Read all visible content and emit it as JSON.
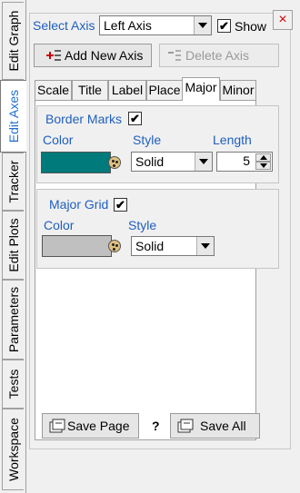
{
  "side_tabs": [
    {
      "label": "Edit Graph",
      "active": false
    },
    {
      "label": "Edit Axes",
      "active": true
    },
    {
      "label": "Tracker",
      "active": false
    },
    {
      "label": "Edit Plots",
      "active": false
    },
    {
      "label": "Parameters",
      "active": false
    },
    {
      "label": "Tests",
      "active": false
    },
    {
      "label": "Workspace",
      "active": false
    }
  ],
  "axis_select": {
    "label": "Select Axis",
    "value": "Left Axis",
    "show_label": "Show",
    "show_checked": true
  },
  "close_symbol": "×",
  "toolbar": {
    "add_label": "Add New Axis",
    "delete_label": "Delete Axis"
  },
  "tabs": [
    "Scale",
    "Title",
    "Label",
    "Place",
    "Major",
    "Minor"
  ],
  "active_tab": "Major",
  "border_marks": {
    "label": "Border Marks",
    "checked": true,
    "color_label": "Color",
    "color": "#007a7a",
    "style_label": "Style",
    "style_value": "Solid",
    "length_label": "Length",
    "length_value": "5"
  },
  "major_grid": {
    "label": "Major Grid",
    "checked": true,
    "color_label": "Color",
    "color": "#c0c0c0",
    "style_label": "Style",
    "style_value": "Solid"
  },
  "footer": {
    "save_page_label": "Save Page",
    "help_label": "?",
    "save_all_label": "Save All"
  },
  "checkmark": "✔"
}
